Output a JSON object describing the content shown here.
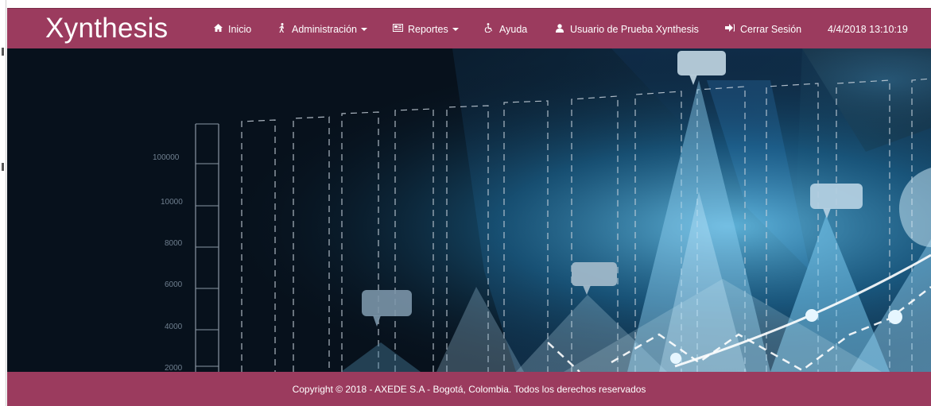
{
  "brand": "Xynthesis",
  "nav": {
    "inicio": "Inicio",
    "administracion": "Administración",
    "reportes": "Reportes",
    "ayuda": "Ayuda",
    "usuario": "Usuario de Prueba Xynthesis",
    "cerrar_sesion": "Cerrar Sesión",
    "datetime": "4/4/2018 13:10:19"
  },
  "hero": {
    "axis_labels": [
      "100000",
      "10000",
      "8000",
      "6000",
      "4000",
      "2000"
    ]
  },
  "footer": {
    "copyright": "Copyright © 2018 - AXEDE S.A - Bogotá, Colombia. Todos los derechos reservados"
  },
  "colors": {
    "brand": "#9b3b5e",
    "hero_background": "#07111c",
    "hero_accent": "#4fb3e0"
  },
  "icons": {
    "inicio": "home-icon",
    "administracion": "person-walking-icon",
    "reportes": "newspaper-icon",
    "ayuda": "accessibility-icon",
    "usuario": "user-icon",
    "cerrar_sesion": "sign-out-icon"
  }
}
